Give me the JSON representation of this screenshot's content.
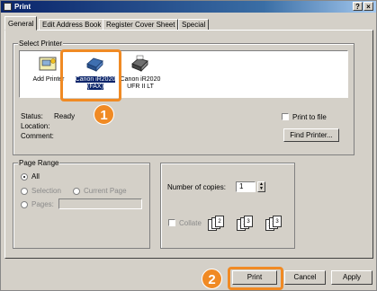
{
  "window": {
    "title": "Print",
    "help_glyph": "?",
    "close_glyph": "×"
  },
  "tabs": [
    {
      "label": "General",
      "active": true
    },
    {
      "label": "Edit Address Book"
    },
    {
      "label": "Register Cover Sheet"
    },
    {
      "label": "Special"
    }
  ],
  "select_printer": {
    "group_label": "Select Printer",
    "printers": [
      {
        "label_line1": "Add Printer",
        "label_line2": "",
        "icon": "add-printer-icon"
      },
      {
        "label_line1": "Canon iR2020",
        "label_line2": "(FAX)",
        "icon": "fax-printer-icon",
        "selected": true
      },
      {
        "label_line1": "Canon iR2020",
        "label_line2": "UFR II LT",
        "icon": "printer-icon"
      }
    ],
    "status_label": "Status:",
    "status_value": "Ready",
    "location_label": "Location:",
    "comment_label": "Comment:",
    "print_to_file_label": "Print to file",
    "find_printer_label": "Find Printer..."
  },
  "page_range": {
    "group_label": "Page Range",
    "options": [
      {
        "label": "All",
        "checked": true
      },
      {
        "label": "Selection"
      },
      {
        "label": "Current Page"
      },
      {
        "label": "Pages:"
      }
    ]
  },
  "copies": {
    "label": "Number of copies:",
    "value": "1",
    "collate_label": "Collate",
    "stacks": [
      [
        "1",
        "1",
        "2"
      ],
      [
        "2",
        "2",
        "3"
      ],
      [
        "3",
        "3",
        "3"
      ]
    ]
  },
  "footer": {
    "print_label": "Print",
    "cancel_label": "Cancel",
    "apply_label": "Apply"
  },
  "annotations": {
    "step1": "1",
    "step2": "2",
    "accent_color": "#f08a24"
  }
}
